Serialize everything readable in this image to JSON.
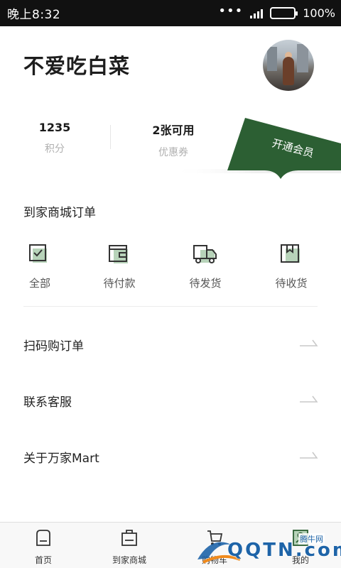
{
  "status_bar": {
    "time": "晚上8:32",
    "battery": "100%"
  },
  "profile": {
    "name": "不爱吃白菜"
  },
  "stats": [
    {
      "value": "1235",
      "label": "积分"
    },
    {
      "value": "2张可用",
      "label": "优惠券"
    }
  ],
  "vip": {
    "label": "开通会员"
  },
  "orders": {
    "title": "到家商城订单",
    "items": [
      {
        "label": "全部",
        "icon": "all-orders-icon"
      },
      {
        "label": "待付款",
        "icon": "wallet-icon"
      },
      {
        "label": "待发货",
        "icon": "truck-icon"
      },
      {
        "label": "待收货",
        "icon": "box-icon"
      }
    ]
  },
  "menu": [
    {
      "label": "扫码购订单"
    },
    {
      "label": "联系客服"
    },
    {
      "label": "关于万家Mart"
    }
  ],
  "bottom_nav": [
    {
      "label": "首页",
      "icon": "home-icon"
    },
    {
      "label": "到家商城",
      "icon": "shopping-bag-icon"
    },
    {
      "label": "购物车",
      "icon": "cart-icon"
    },
    {
      "label": "我的",
      "icon": "user-icon"
    }
  ],
  "watermark": {
    "text": "QQTN.com",
    "small": "腾牛网"
  },
  "colors": {
    "accent": "#2c5f33",
    "icon_fill": "#b7d3b9",
    "statusbar": "#111111"
  }
}
